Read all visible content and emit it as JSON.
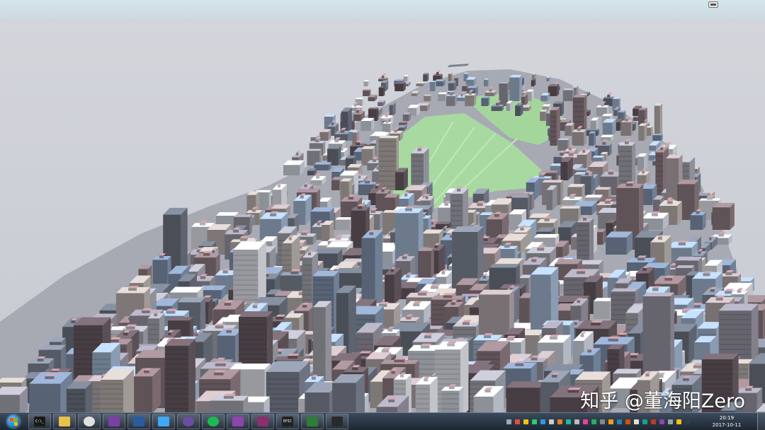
{
  "watermark": "知乎 @董海阳Zero",
  "taskbar": {
    "start_icon": "windows-start-orb",
    "apps": [
      {
        "name": "cmd-icon",
        "label": "C:\\_"
      },
      {
        "name": "explorer-icon",
        "label": ""
      },
      {
        "name": "chrome-icon",
        "label": ""
      },
      {
        "name": "visual-studio-icon",
        "label": ""
      },
      {
        "name": "unreal-engine-icon",
        "label": ""
      },
      {
        "name": "sourcetree-icon",
        "label": ""
      },
      {
        "name": "eclipse-icon",
        "label": ""
      },
      {
        "name": "spotify-icon",
        "label": ""
      },
      {
        "name": "visual-studio-2-icon",
        "label": ""
      },
      {
        "name": "winrar-icon",
        "label": ""
      },
      {
        "name": "epic-games-icon",
        "label": "EPIC"
      },
      {
        "name": "monitor-icon",
        "label": ""
      },
      {
        "name": "unreal-engine-2-icon",
        "label": ""
      }
    ],
    "clock_time": "20:19",
    "clock_date": "2017-10-11"
  }
}
